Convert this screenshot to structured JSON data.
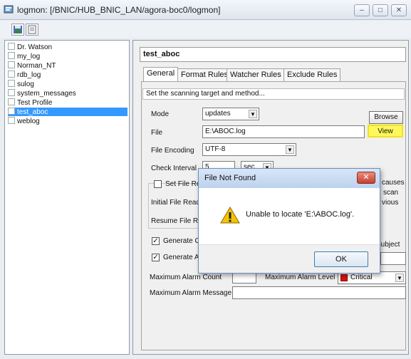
{
  "window": {
    "title": "logmon: [/BNIC/HUB_BNIC_LAN/agora-boc0/logmon]",
    "buttons": {
      "minimize": "–",
      "maximize": "□",
      "close": "✕"
    }
  },
  "toolbar": {
    "icons": [
      "save-icon",
      "document-icon"
    ]
  },
  "tree": {
    "items": [
      {
        "label": "Dr. Watson",
        "selected": false
      },
      {
        "label": "my_log",
        "selected": false
      },
      {
        "label": "Norman_NT",
        "selected": false
      },
      {
        "label": "rdb_log",
        "selected": false
      },
      {
        "label": "sulog",
        "selected": false
      },
      {
        "label": "system_messages",
        "selected": false
      },
      {
        "label": "Test Profile",
        "selected": false
      },
      {
        "label": "test_aboc",
        "selected": true
      },
      {
        "label": "weblog",
        "selected": false
      }
    ]
  },
  "profile": {
    "name": "test_aboc"
  },
  "tabs": [
    {
      "label": "General",
      "active": true
    },
    {
      "label": "Format Rules",
      "active": false
    },
    {
      "label": "Watcher Rules",
      "active": false
    },
    {
      "label": "Exclude Rules",
      "active": false
    }
  ],
  "general": {
    "description": "Set the scanning target and method...",
    "mode": {
      "label": "Mode",
      "value": "updates"
    },
    "browse_label": "Browse",
    "file": {
      "label": "File",
      "value": "E:\\ABOC.log"
    },
    "view_label": "View",
    "encoding": {
      "label": "File Encoding",
      "value": "UTF-8"
    },
    "check_interval": {
      "label": "Check Interval",
      "value": "5",
      "unit": "sec"
    },
    "set_file_label": "Set File Re",
    "initial_file_label": "Initial File Read",
    "resume_file_label": "Resume File Re",
    "right_fragments": {
      "causes": "causes",
      "scan": "scan",
      "vious": "vious"
    },
    "generate1": {
      "label": "Generate C",
      "checked": true
    },
    "generate2": {
      "label": "Generate A",
      "checked": true
    },
    "subject_label": "Subject",
    "max_alarm_count_label": "Maximum Alarm Count",
    "max_alarm_level_label": "Maximum Alarm Level",
    "max_alarm_level_value": "Critical",
    "max_alarm_message_label": "Maximum Alarm Message",
    "max_alarm_message_value": ""
  },
  "dialog": {
    "title": "File Not Found",
    "message": "Unable to locate 'E:\\ABOC.log'.",
    "ok_label": "OK",
    "close_glyph": "✕"
  },
  "colors": {
    "selection": "#3399ff",
    "highlight": "#fff85a",
    "dialog_close": "#c6402d",
    "warning": "#f6c300"
  }
}
